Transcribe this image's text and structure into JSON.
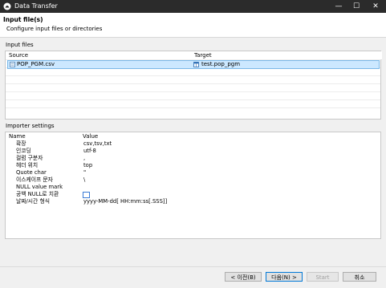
{
  "window": {
    "title": "Data Transfer",
    "minimize_glyph": "—",
    "maximize_glyph": "☐",
    "close_glyph": "✕"
  },
  "header": {
    "title": "Input file(s)",
    "subtitle": "Configure input files or directories"
  },
  "input_files": {
    "group_label": "Input files",
    "columns": {
      "source": "Source",
      "target": "Target"
    },
    "rows": [
      {
        "source": "POP_PGM.csv",
        "target": "test.pop_pgm",
        "selected": true
      }
    ]
  },
  "importer": {
    "group_label": "Importer settings",
    "columns": {
      "name": "Name",
      "value": "Value"
    },
    "properties": [
      {
        "name": "확장",
        "value": "csv,tsv,txt"
      },
      {
        "name": "인코딩",
        "value": "utf-8"
      },
      {
        "name": "컬럼 구분자",
        "value": ","
      },
      {
        "name": "헤더 위치",
        "value": "top"
      },
      {
        "name": "Quote char",
        "value": "\""
      },
      {
        "name": "이스케이프 문자",
        "value": "\\"
      },
      {
        "name": "NULL value mark",
        "value": ""
      },
      {
        "name": "공백 NULL로 치환",
        "value": ""
      },
      {
        "name": "날짜/시간 형식",
        "value": "yyyy-MM-dd[ HH:mm:ss[.SSS]]"
      }
    ],
    "empty_as_null_checked": false
  },
  "footer": {
    "back": "< 이전(B)",
    "next": "다음(N) >",
    "start": "Start",
    "cancel": "취소"
  },
  "colors": {
    "titlebar": "#2b2b2b",
    "selection": "#cce8ff",
    "accent": "#0078d7"
  }
}
